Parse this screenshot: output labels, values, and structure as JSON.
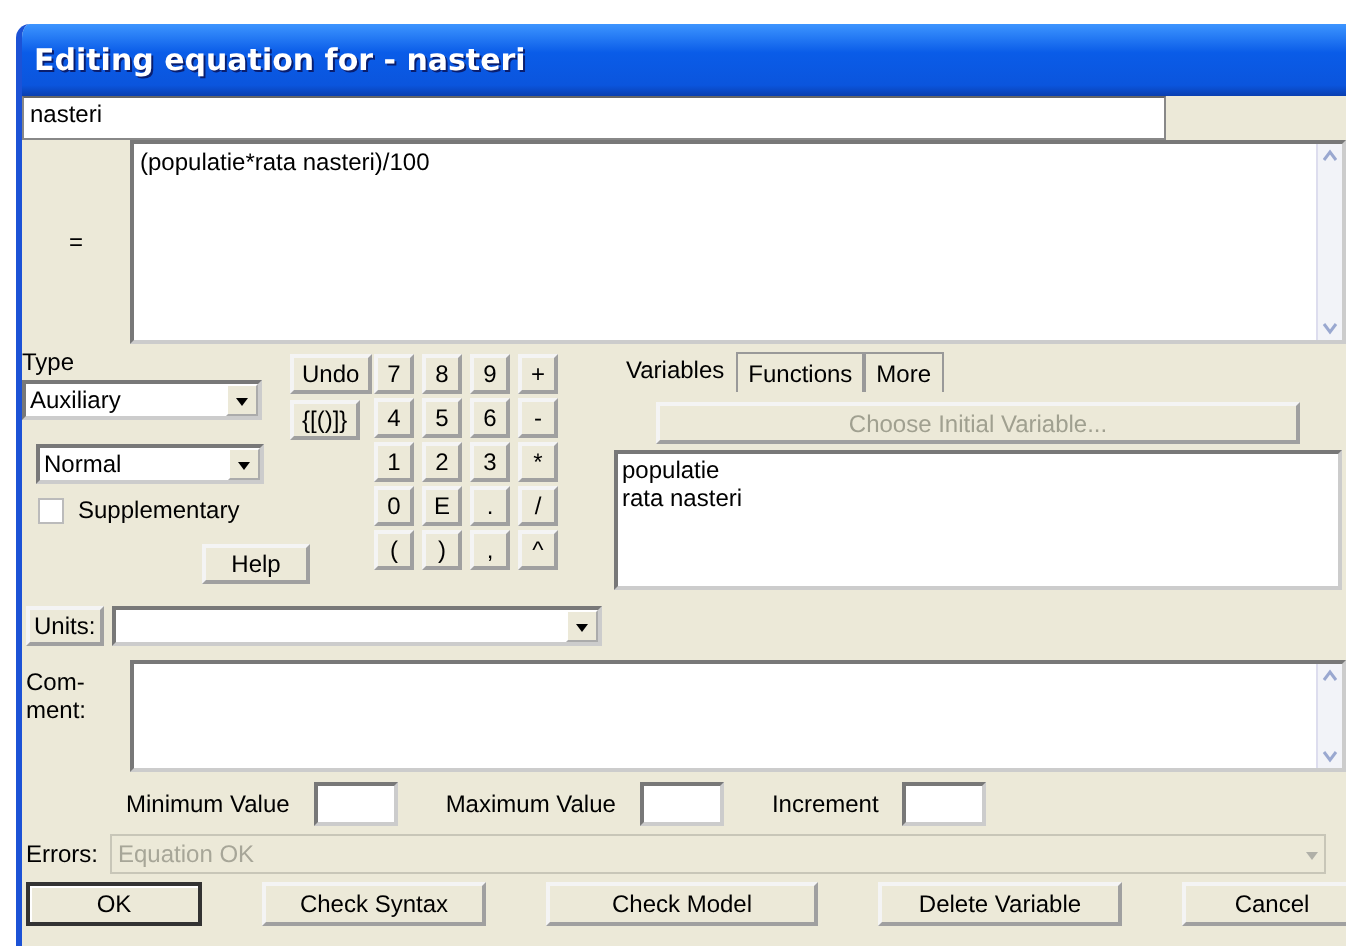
{
  "window": {
    "title": "Editing equation for - nasteri"
  },
  "name_field": {
    "value": "nasteri"
  },
  "equation": {
    "label": "=",
    "value": "(populatie*rata nasteri)/100"
  },
  "type": {
    "label": "Type",
    "value": "Auxiliary"
  },
  "subtype": {
    "value": "Normal"
  },
  "supplementary": {
    "label": "Supplementary",
    "checked": false
  },
  "undo_button": "Undo",
  "brackets_button": "{[()]}",
  "help_button": "Help",
  "keypad": [
    "7",
    "8",
    "9",
    "+",
    "4",
    "5",
    "6",
    "-",
    "1",
    "2",
    "3",
    "*",
    "0",
    "E",
    ".",
    "/",
    "(",
    ")",
    ",",
    "^"
  ],
  "tabs": [
    {
      "label": "Variables",
      "selected": true
    },
    {
      "label": "Functions",
      "selected": false
    },
    {
      "label": "More",
      "selected": false
    }
  ],
  "choose_button": {
    "label": "Choose Initial Variable...",
    "disabled": true
  },
  "variables": [
    "populatie",
    "rata nasteri"
  ],
  "units": {
    "label": "Units:"
  },
  "comment": {
    "label": "Com- ment:"
  },
  "ranges": [
    {
      "label": "Minimum Value"
    },
    {
      "label": "Maximum Value"
    },
    {
      "label": "Increment"
    }
  ],
  "errors": {
    "label": "Errors:",
    "value": "Equation OK",
    "disabled": true
  },
  "buttons": [
    {
      "label": "OK",
      "default": true
    },
    {
      "label": "Check Syntax",
      "default": false
    },
    {
      "label": "Check Model",
      "default": false
    },
    {
      "label": "Delete Variable",
      "default": false
    },
    {
      "label": "Cancel",
      "default": false
    }
  ]
}
